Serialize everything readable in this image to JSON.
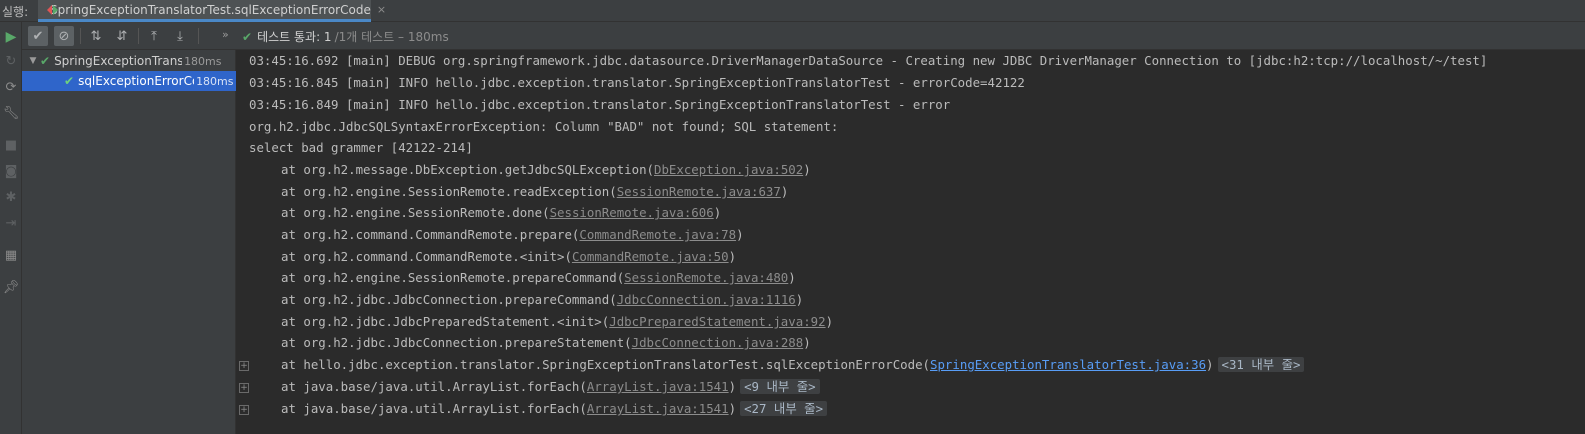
{
  "run_label": "실행:",
  "tab": {
    "title": "SpringExceptionTranslatorTest.sqlExceptionErrorCode",
    "close": "×"
  },
  "toolbar": {
    "chevron": "»",
    "status_pass": "테스트 통과: 1",
    "status_rest": "/1개 테스트 – 180ms"
  },
  "tree": {
    "parent": {
      "label": "SpringExceptionTranslatorTest",
      "time": "180ms"
    },
    "child": {
      "label": "sqlExceptionErrorCode",
      "time": "180ms"
    }
  },
  "console": {
    "log_lines": [
      "03:45:16.692 [main] DEBUG org.springframework.jdbc.datasource.DriverManagerDataSource - Creating new JDBC DriverManager Connection to [jdbc:h2:tcp://localhost/~/test]",
      "03:45:16.845 [main] INFO hello.jdbc.exception.translator.SpringExceptionTranslatorTest - errorCode=42122",
      "03:45:16.849 [main] INFO hello.jdbc.exception.translator.SpringExceptionTranslatorTest - error",
      "org.h2.jdbc.JdbcSQLSyntaxErrorException: Column \"BAD\" not found; SQL statement:",
      "select bad grammer [42122-214]"
    ],
    "stack": [
      {
        "prefix": "at org.h2.message.DbException.getJdbcSQLException(",
        "link": "DbException.java:502",
        "suffix": ")"
      },
      {
        "prefix": "at org.h2.engine.SessionRemote.readException(",
        "link": "SessionRemote.java:637",
        "suffix": ")"
      },
      {
        "prefix": "at org.h2.engine.SessionRemote.done(",
        "link": "SessionRemote.java:606",
        "suffix": ")"
      },
      {
        "prefix": "at org.h2.command.CommandRemote.prepare(",
        "link": "CommandRemote.java:78",
        "suffix": ")"
      },
      {
        "prefix": "at org.h2.command.CommandRemote.<init>(",
        "link": "CommandRemote.java:50",
        "suffix": ")"
      },
      {
        "prefix": "at org.h2.engine.SessionRemote.prepareCommand(",
        "link": "SessionRemote.java:480",
        "suffix": ")"
      },
      {
        "prefix": "at org.h2.jdbc.JdbcConnection.prepareCommand(",
        "link": "JdbcConnection.java:1116",
        "suffix": ")"
      },
      {
        "prefix": "at org.h2.jdbc.JdbcPreparedStatement.<init>(",
        "link": "JdbcPreparedStatement.java:92",
        "suffix": ")"
      },
      {
        "prefix": "at org.h2.jdbc.JdbcConnection.prepareStatement(",
        "link": "JdbcConnection.java:288",
        "suffix": ")"
      },
      {
        "prefix": "at hello.jdbc.exception.translator.SpringExceptionTranslatorTest.sqlExceptionErrorCode(",
        "link": "SpringExceptionTranslatorTest.java:36",
        "suffix": ")",
        "badge": "<31 내부 줄>"
      },
      {
        "prefix": "at java.base/java.util.ArrayList.forEach(",
        "link": "ArrayList.java:1541",
        "suffix": ")",
        "badge": "<9 내부 줄>"
      },
      {
        "prefix": "at java.base/java.util.ArrayList.forEach(",
        "link": "ArrayList.java:1541",
        "suffix": ")",
        "badge": "<27 내부 줄>"
      }
    ]
  },
  "icons": {
    "rerun": "play-icon",
    "passed_filter": "check-icon",
    "ignored_filter": "cancel-circle-icon",
    "sort_alpha": "sort-alpha-icon",
    "sort_duration": "sort-duration-icon",
    "expand_all": "expand-all-icon",
    "collapse_all": "collapse-all-icon"
  },
  "colors": {
    "accent": "#4a88c7",
    "pass": "#59a869",
    "selection": "#2f65ca",
    "link": "#589df6"
  }
}
